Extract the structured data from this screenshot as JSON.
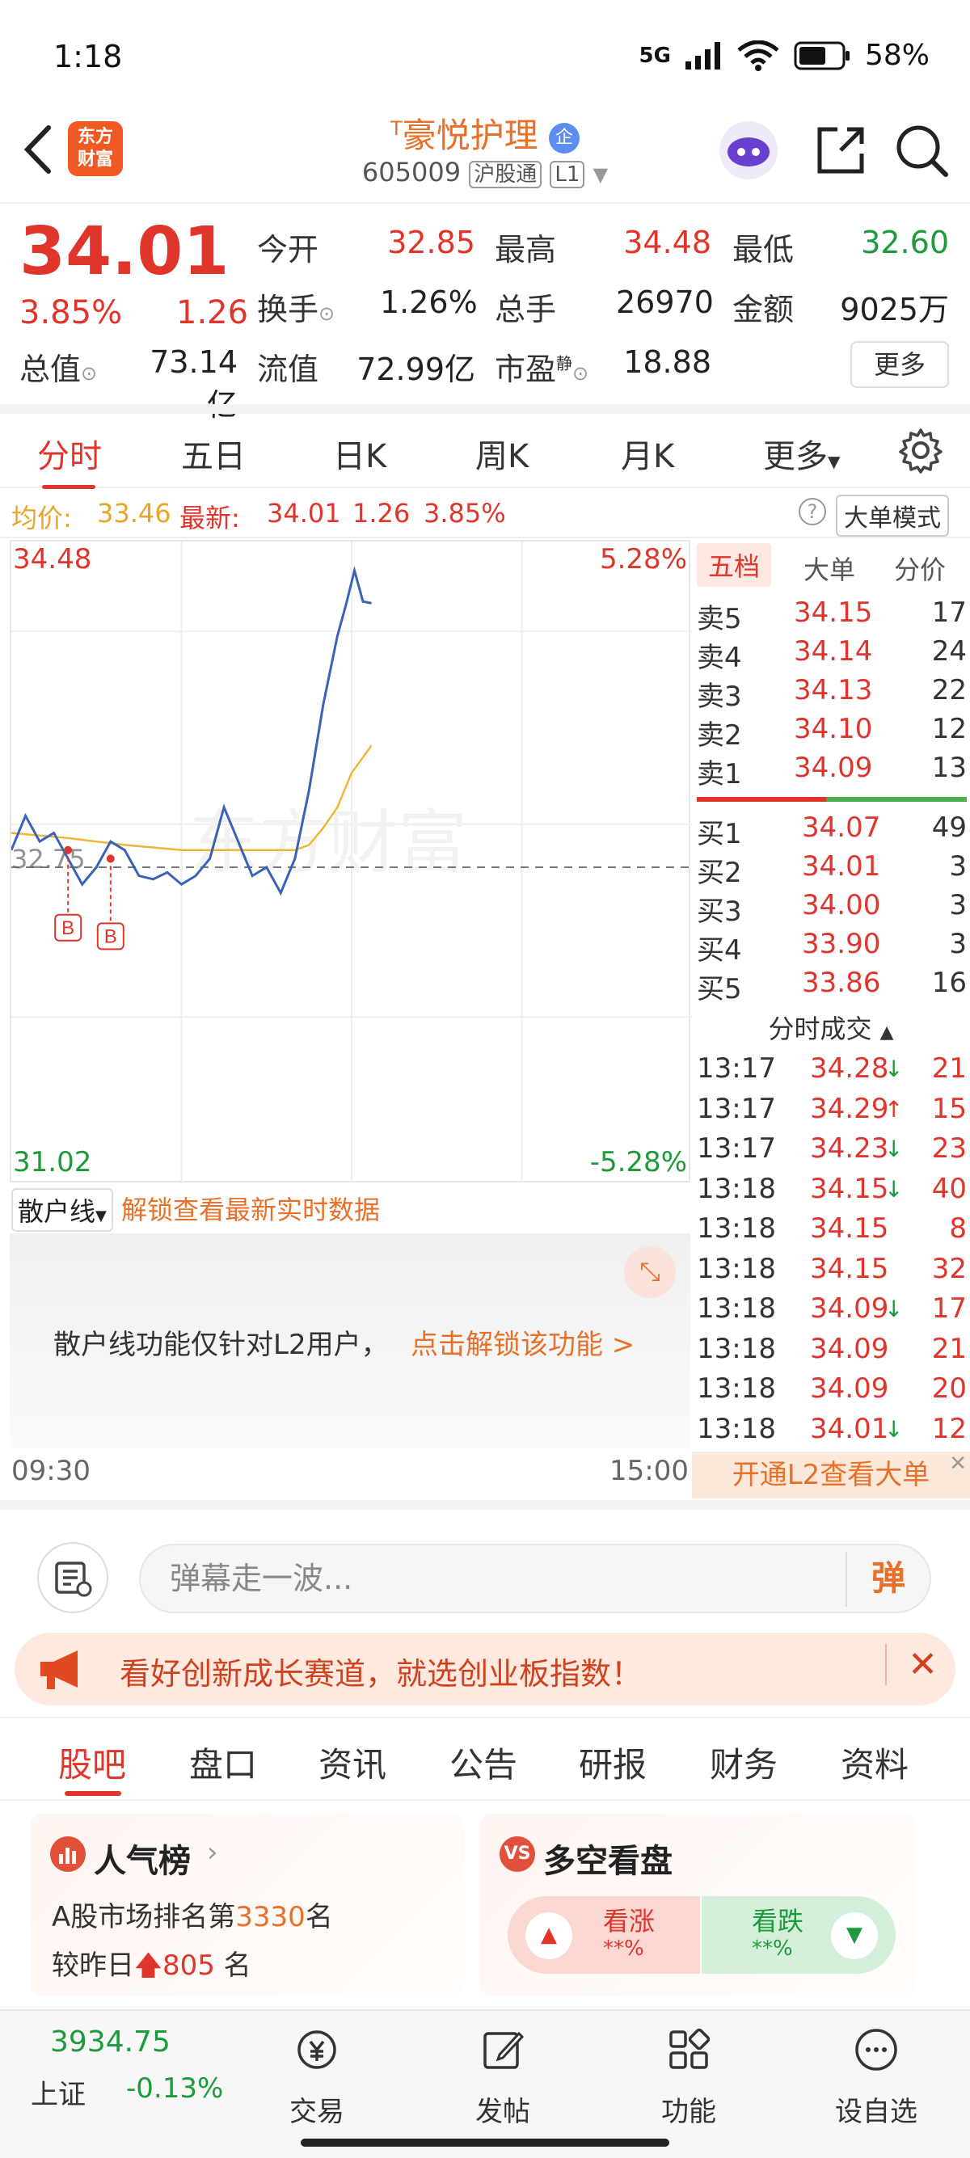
{
  "status_bar": {
    "time": "1:18",
    "network": "5G",
    "battery": "58%"
  },
  "header": {
    "logo_text": "东方财富",
    "stock_name": "豪悦护理",
    "prefix_tag": "T",
    "code": "605009",
    "tag_hgt": "沪股通",
    "tag_level": "L1"
  },
  "quote": {
    "price": "34.01",
    "change_pct": "3.85%",
    "change": "1.26",
    "open_label": "今开",
    "open": "32.85",
    "high_label": "最高",
    "high": "34.48",
    "low_label": "最低",
    "low": "32.60",
    "turnover_label": "换手",
    "turnover": "1.26%",
    "volume_label": "总手",
    "volume": "26970",
    "amount_label": "金额",
    "amount": "9025万",
    "mktcap_label": "总值",
    "mktcap": "73.14亿",
    "float_label": "流值",
    "float": "72.99亿",
    "pe_label": "市盈",
    "pe_sup": "静",
    "pe": "18.88",
    "more": "更多"
  },
  "period_tabs": [
    "分时",
    "五日",
    "日K",
    "周K",
    "月K",
    "更多"
  ],
  "info": {
    "avg_label": "均价:",
    "avg": "33.46",
    "latest_label": "最新:",
    "latest": "34.01",
    "change": "1.26",
    "change_pct": "3.85%",
    "mode": "大单模式"
  },
  "chart": {
    "y_max": "34.48",
    "y_min": "31.02",
    "pct_max": "5.28%",
    "pct_min": "-5.28%",
    "prev_close": "32.75",
    "watermark": "东方财富",
    "buy_marker": "B",
    "time_start": "09:30",
    "time_end": "15:00"
  },
  "chart_data": {
    "type": "line",
    "x_range": [
      "09:30",
      "15:00"
    ],
    "ylim": [
      31.02,
      34.48
    ],
    "prev_close": 32.75,
    "series": [
      {
        "name": "最新",
        "x": [
          0,
          5,
          10,
          15,
          20,
          25,
          30,
          35,
          40,
          45,
          50,
          55,
          60,
          65,
          70,
          75,
          80,
          85,
          90,
          95,
          100,
          105,
          110,
          115,
          118,
          121,
          124,
          127
        ],
        "y": [
          32.85,
          33.05,
          32.9,
          32.95,
          32.8,
          32.65,
          32.75,
          32.9,
          32.85,
          32.7,
          32.68,
          32.72,
          32.65,
          32.7,
          32.8,
          33.1,
          32.9,
          32.7,
          32.75,
          32.6,
          32.8,
          33.2,
          33.7,
          34.1,
          34.28,
          34.48,
          34.3,
          34.29
        ]
      },
      {
        "name": "均价",
        "x": [
          0,
          20,
          40,
          60,
          80,
          100,
          105,
          110,
          115,
          120,
          127
        ],
        "y": [
          32.95,
          32.92,
          32.88,
          32.85,
          32.85,
          32.85,
          32.88,
          32.98,
          33.1,
          33.3,
          33.46
        ]
      }
    ],
    "buy_points": [
      {
        "x": 20,
        "y": 32.85
      },
      {
        "x": 35,
        "y": 32.8
      }
    ]
  },
  "order_book": {
    "tabs": [
      "五档",
      "大单",
      "分价"
    ],
    "asks": [
      {
        "label": "卖5",
        "price": "34.15",
        "vol": "17"
      },
      {
        "label": "卖4",
        "price": "34.14",
        "vol": "24"
      },
      {
        "label": "卖3",
        "price": "34.13",
        "vol": "22"
      },
      {
        "label": "卖2",
        "price": "34.10",
        "vol": "12"
      },
      {
        "label": "卖1",
        "price": "34.09",
        "vol": "13"
      }
    ],
    "bids": [
      {
        "label": "买1",
        "price": "34.07",
        "vol": "49"
      },
      {
        "label": "买2",
        "price": "34.01",
        "vol": "3"
      },
      {
        "label": "买3",
        "price": "34.00",
        "vol": "3"
      },
      {
        "label": "买4",
        "price": "33.90",
        "vol": "3"
      },
      {
        "label": "买5",
        "price": "33.86",
        "vol": "16"
      }
    ],
    "trades_title": "分时成交",
    "trades": [
      {
        "time": "13:17",
        "price": "34.28",
        "dir": "↓",
        "vol": "21"
      },
      {
        "time": "13:17",
        "price": "34.29",
        "dir": "↑",
        "vol": "15"
      },
      {
        "time": "13:17",
        "price": "34.23",
        "dir": "↓",
        "vol": "23"
      },
      {
        "time": "13:18",
        "price": "34.15",
        "dir": "↓",
        "vol": "40"
      },
      {
        "time": "13:18",
        "price": "34.15",
        "dir": "",
        "vol": "8"
      },
      {
        "time": "13:18",
        "price": "34.15",
        "dir": "",
        "vol": "32"
      },
      {
        "time": "13:18",
        "price": "34.09",
        "dir": "↓",
        "vol": "17"
      },
      {
        "time": "13:18",
        "price": "34.09",
        "dir": "",
        "vol": "21"
      },
      {
        "time": "13:18",
        "price": "34.09",
        "dir": "",
        "vol": "20"
      },
      {
        "time": "13:18",
        "price": "34.01",
        "dir": "↓",
        "vol": "12"
      }
    ],
    "l2_banner": "开通L2查看大单"
  },
  "retail": {
    "selector": "散户线",
    "unlock_link": "解锁查看最新实时数据",
    "notice": "散户线功能仅针对L2用户，",
    "notice_link": "点击解锁该功能 >"
  },
  "comment": {
    "placeholder": "弹幕走一波...",
    "danmu": "弹"
  },
  "ad": {
    "text": "看好创新成长赛道，就选创业板指数！"
  },
  "news_tabs": [
    "股吧",
    "盘口",
    "资讯",
    "公告",
    "研报",
    "财务",
    "资料"
  ],
  "popularity": {
    "title": "人气榜",
    "rank_prefix": "A股市场排名第",
    "rank": "3330",
    "rank_suffix": "名",
    "change_prefix": "较昨日",
    "change": "805",
    "change_suffix": " 名"
  },
  "sentiment": {
    "title": "多空看盘",
    "bull": "看涨",
    "bull_pct": "**%",
    "bear": "看跌",
    "bear_pct": "**%"
  },
  "bottom_nav": {
    "index_value": "3934.75",
    "index_name": "上证",
    "index_change": "-0.13%",
    "items": [
      "交易",
      "发帖",
      "功能",
      "设自选"
    ]
  },
  "colors": {
    "up": "#e0352b",
    "down": "#1d9a3c",
    "accent": "#e8702a",
    "price_line": "#3a62b8",
    "avg_line": "#f0b63a"
  }
}
